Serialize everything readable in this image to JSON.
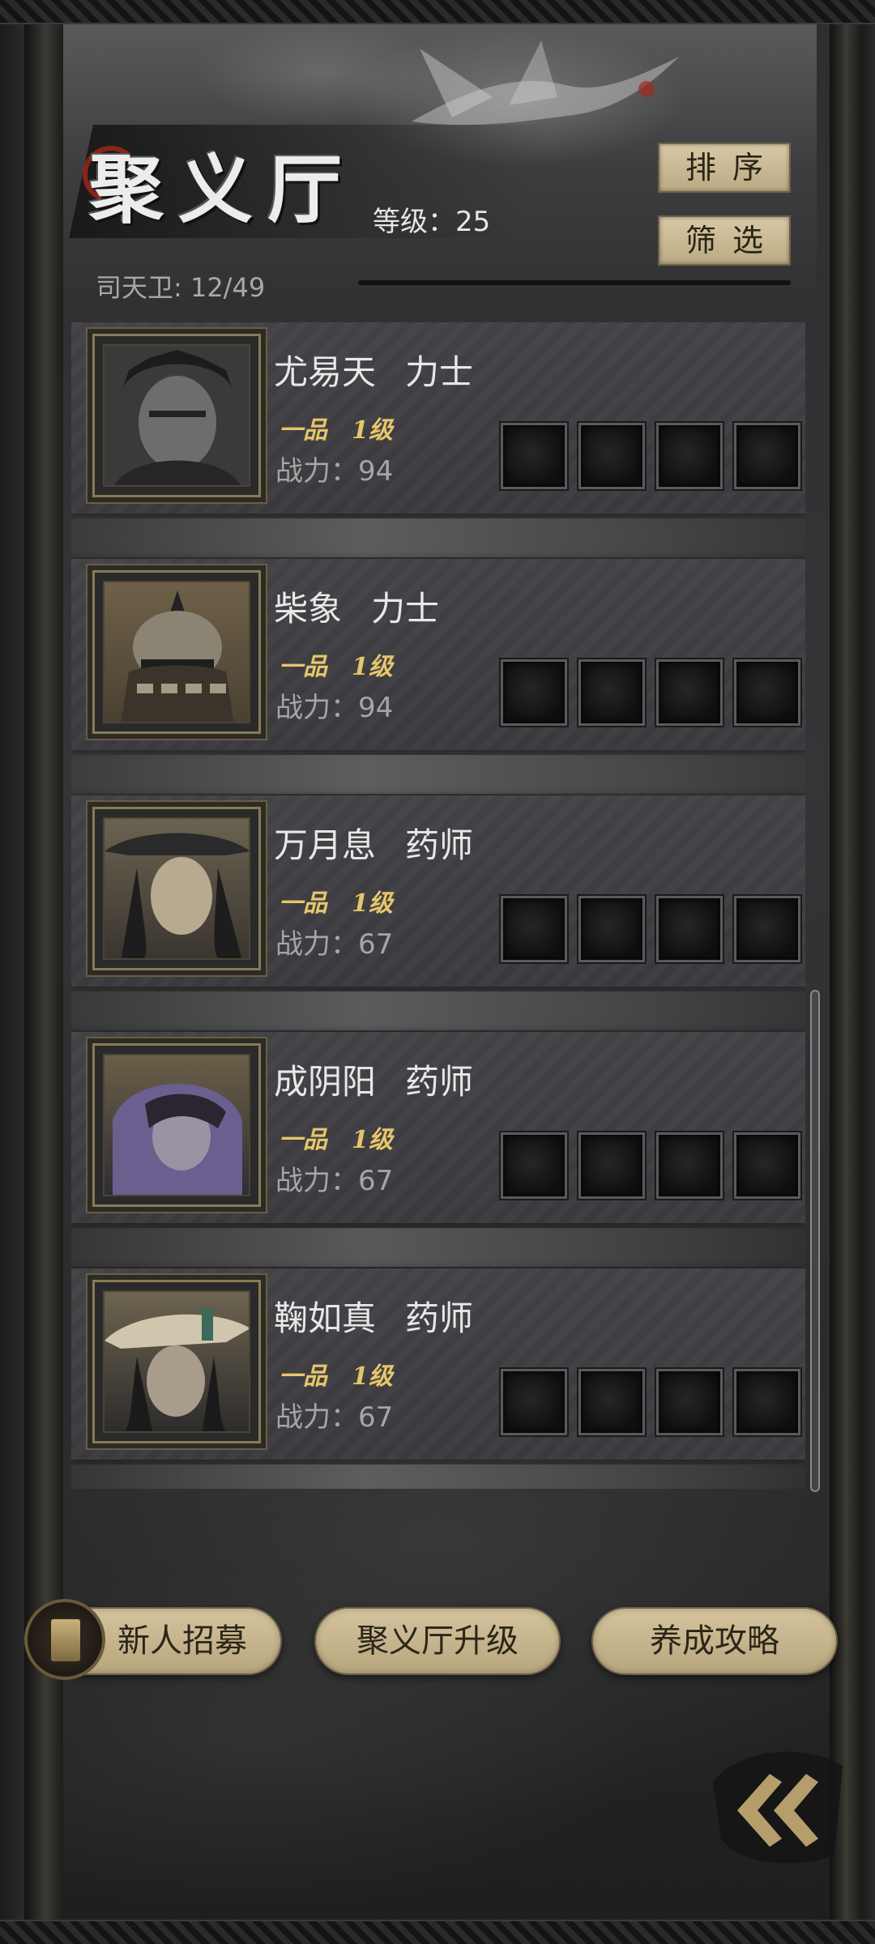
{
  "header": {
    "title": "聚义厅",
    "level_text": "等级：25",
    "member_count": "司天卫: 12/49",
    "sort_label": "排序",
    "filter_label": "筛选"
  },
  "heroes": [
    {
      "name": "尤易天",
      "class": "力士",
      "grade": "一品",
      "level": "1级",
      "power": "战力：94"
    },
    {
      "name": "柴象",
      "class": "力士",
      "grade": "一品",
      "level": "1级",
      "power": "战力：94"
    },
    {
      "name": "万月息",
      "class": "药师",
      "grade": "一品",
      "level": "1级",
      "power": "战力：67"
    },
    {
      "name": "成阴阳",
      "class": "药师",
      "grade": "一品",
      "level": "1级",
      "power": "战力：67"
    },
    {
      "name": "鞠如真",
      "class": "药师",
      "grade": "一品",
      "level": "1级",
      "power": "战力：67"
    }
  ],
  "actions": {
    "recruit": "新人招募",
    "upgrade": "聚义厅升级",
    "guide": "养成攻略"
  },
  "icons": {
    "back": "double-chevron-left-icon",
    "recruit_badge": "recruit-token-icon",
    "equipment_slot": "empty-equipment-slot-icon"
  },
  "colors": {
    "accent_gold": "#e6c66a",
    "button_tan": "#c9b890",
    "panel": "#3f3f43"
  }
}
